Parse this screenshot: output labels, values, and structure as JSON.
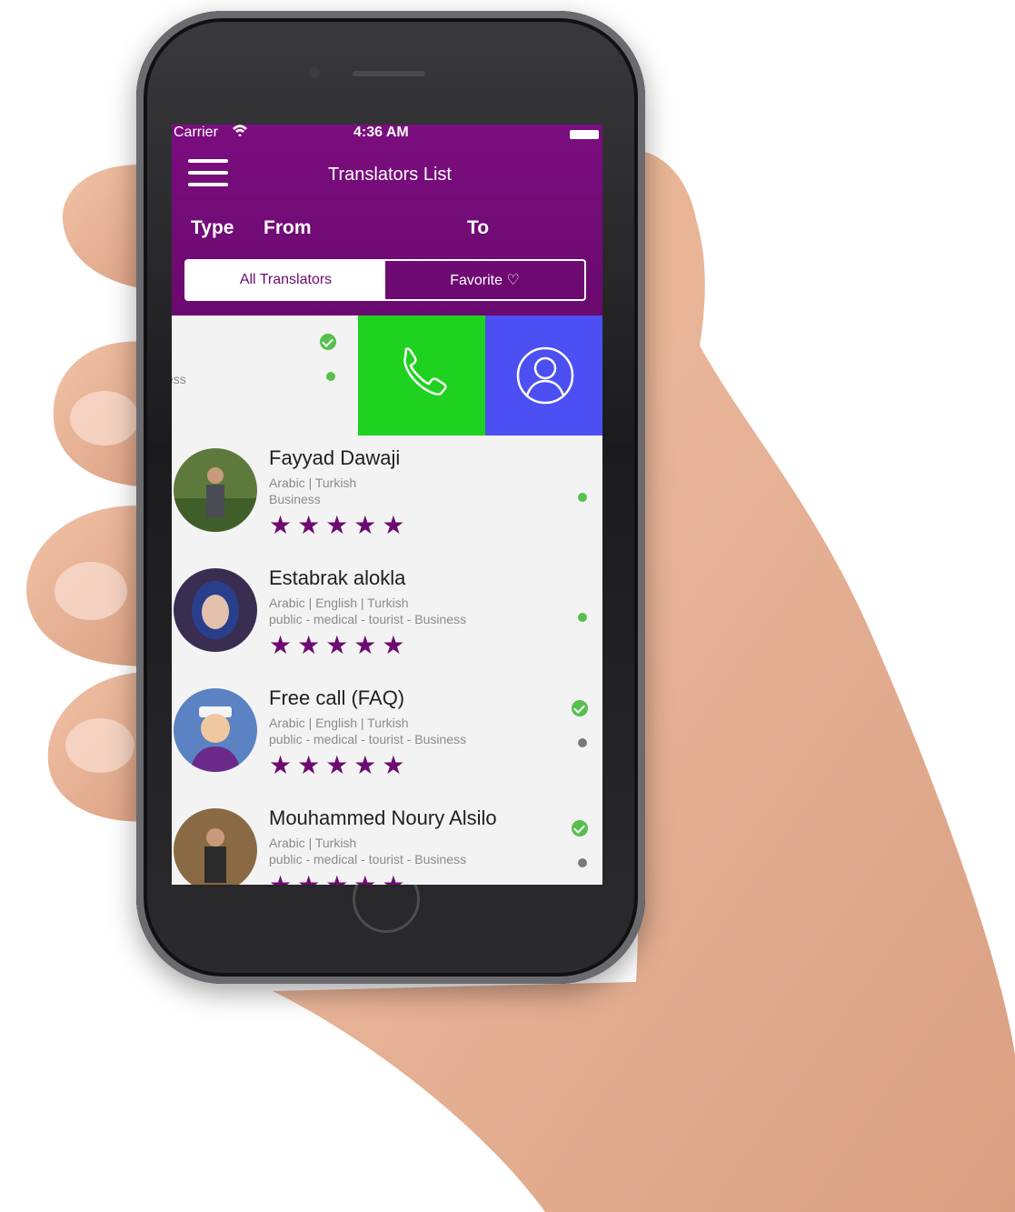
{
  "status_bar": {
    "carrier": "Carrier",
    "wifi_icon": "wifi-icon",
    "time": "4:36 AM"
  },
  "header": {
    "title": "Translators List",
    "menu_icon": "hamburger-icon"
  },
  "filters": {
    "type": "Type",
    "from": "From",
    "to": "To"
  },
  "segments": {
    "all": "All Translators",
    "favorite": "Favorite ♡"
  },
  "swiped_row": {
    "edge_text": "ess",
    "call_icon": "phone-icon",
    "profile_icon": "user-icon"
  },
  "translators": [
    {
      "name": "Fayyad Dawaji",
      "languages": "Arabic | Turkish",
      "fields": "Business",
      "stars": "★★★★★",
      "verified": false,
      "online": true
    },
    {
      "name": "Estabrak alokla",
      "languages": "Arabic | English | Turkish",
      "fields": "public - medical - tourist -  Business",
      "stars": "★★★★★",
      "verified": false,
      "online": true
    },
    {
      "name": "Free call (FAQ)",
      "languages": "Arabic | English | Turkish",
      "fields": "public - medical - tourist -  Business",
      "stars": "★★★★★",
      "verified": true,
      "online": false
    },
    {
      "name": "Mouhammed Noury Alsilo",
      "languages": "Arabic | Turkish",
      "fields": "public - medical - tourist -  Business",
      "stars": "★★★★★",
      "verified": true,
      "online": false
    }
  ],
  "colors": {
    "primary": "#6d0b72",
    "online": "#57bf4e",
    "offline": "#7a7a7a",
    "call_action": "#1fd21f",
    "profile_action": "#4c4ff2"
  }
}
